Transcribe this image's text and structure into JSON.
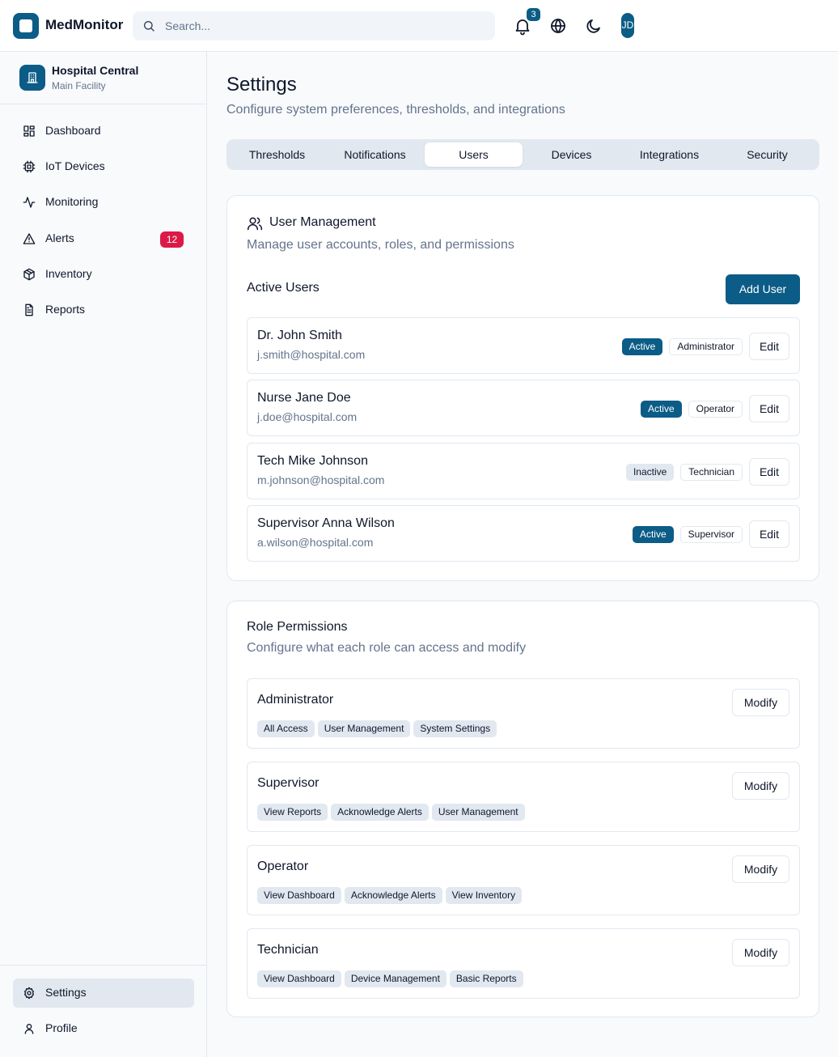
{
  "app": {
    "name": "MedMonitor"
  },
  "search": {
    "placeholder": "Search..."
  },
  "topbar": {
    "notification_count": "3",
    "avatar_initials": "JD"
  },
  "facility": {
    "name": "Hospital Central",
    "subtitle": "Main Facility"
  },
  "sidebar": {
    "items": [
      {
        "label": "Dashboard",
        "icon": "dashboard-icon"
      },
      {
        "label": "IoT Devices",
        "icon": "chip-icon"
      },
      {
        "label": "Monitoring",
        "icon": "activity-icon"
      },
      {
        "label": "Alerts",
        "icon": "alert-triangle-icon",
        "badge": "12"
      },
      {
        "label": "Inventory",
        "icon": "package-icon"
      },
      {
        "label": "Reports",
        "icon": "file-text-icon"
      }
    ],
    "bottom": [
      {
        "label": "Settings",
        "icon": "gear-icon",
        "active": true
      },
      {
        "label": "Profile",
        "icon": "user-icon"
      }
    ]
  },
  "page": {
    "title": "Settings",
    "subtitle": "Configure system preferences, thresholds, and integrations"
  },
  "tabs": [
    {
      "label": "Thresholds"
    },
    {
      "label": "Notifications"
    },
    {
      "label": "Users",
      "active": true
    },
    {
      "label": "Devices"
    },
    {
      "label": "Integrations"
    },
    {
      "label": "Security"
    }
  ],
  "user_management": {
    "title": "User Management",
    "subtitle": "Manage user accounts, roles, and permissions",
    "section_title": "Active Users",
    "add_button": "Add User",
    "edit_label": "Edit",
    "users": [
      {
        "name": "Dr. John Smith",
        "email": "j.smith@hospital.com",
        "status": "Active",
        "role": "Administrator"
      },
      {
        "name": "Nurse Jane Doe",
        "email": "j.doe@hospital.com",
        "status": "Active",
        "role": "Operator"
      },
      {
        "name": "Tech Mike Johnson",
        "email": "m.johnson@hospital.com",
        "status": "Inactive",
        "role": "Technician"
      },
      {
        "name": "Supervisor Anna Wilson",
        "email": "a.wilson@hospital.com",
        "status": "Active",
        "role": "Supervisor"
      }
    ]
  },
  "role_permissions": {
    "title": "Role Permissions",
    "subtitle": "Configure what each role can access and modify",
    "modify_label": "Modify",
    "roles": [
      {
        "name": "Administrator",
        "permissions": [
          "All Access",
          "User Management",
          "System Settings"
        ]
      },
      {
        "name": "Supervisor",
        "permissions": [
          "View Reports",
          "Acknowledge Alerts",
          "User Management"
        ]
      },
      {
        "name": "Operator",
        "permissions": [
          "View Dashboard",
          "Acknowledge Alerts",
          "View Inventory"
        ]
      },
      {
        "name": "Technician",
        "permissions": [
          "View Dashboard",
          "Device Management",
          "Basic Reports"
        ]
      }
    ]
  },
  "colors": {
    "primary": "#0b5c86",
    "alert_badge": "#dc1947",
    "border": "#e2e8f0",
    "muted_text": "#64748b",
    "background": "#f8fafc"
  }
}
